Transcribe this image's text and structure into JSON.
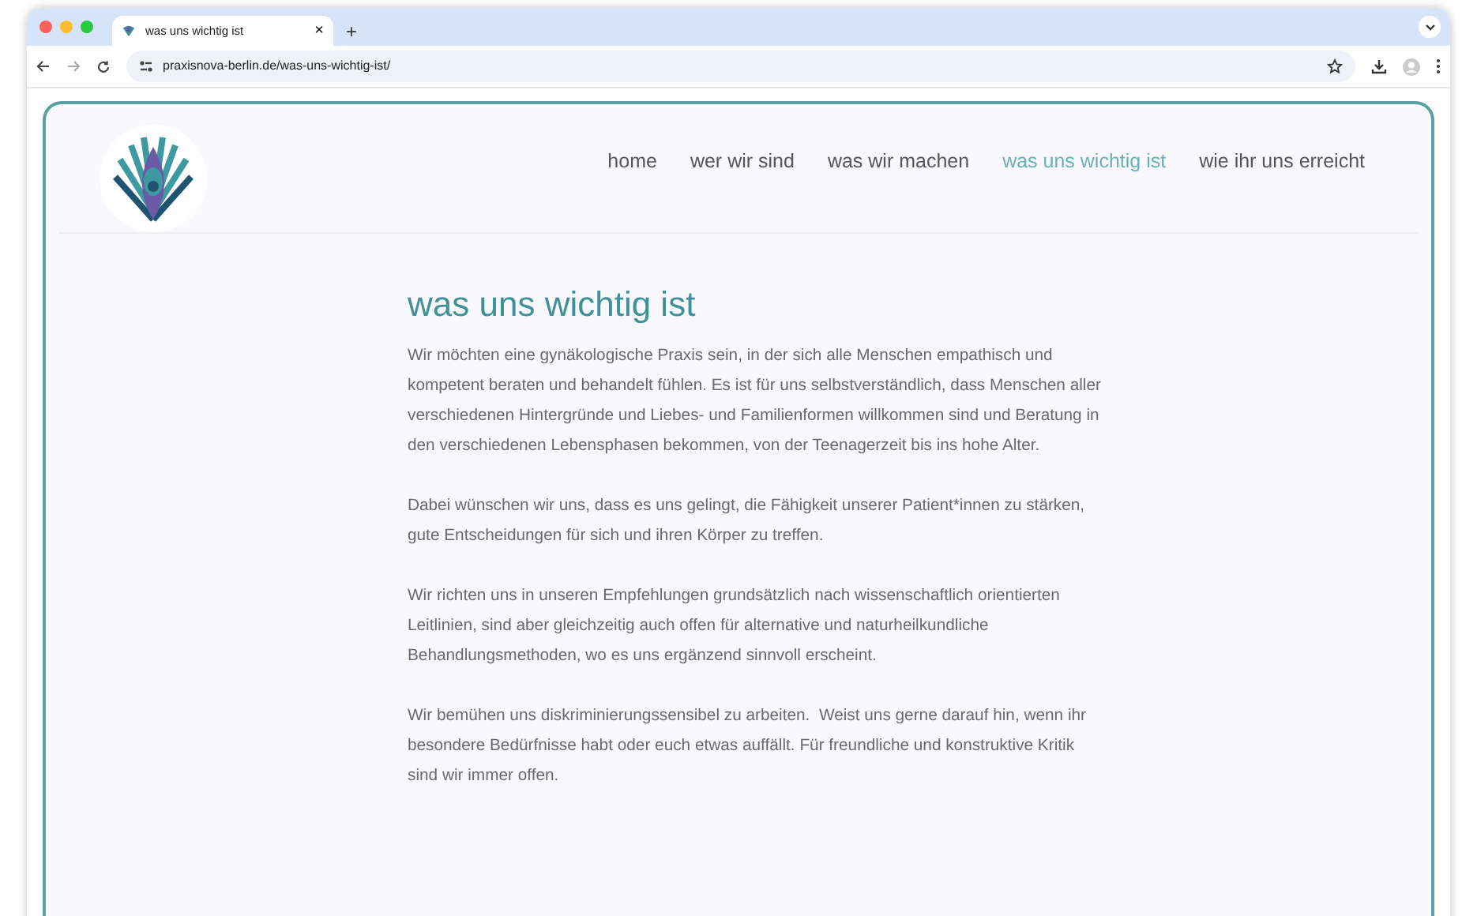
{
  "browser": {
    "tab": {
      "title": "was uns wichtig ist",
      "close": "×"
    },
    "new_tab": "+",
    "url": "praxisnova-berlin.de/was-uns-wichtig-ist/"
  },
  "page": {
    "nav": [
      {
        "label": "home",
        "selected": false
      },
      {
        "label": "wer wir sind",
        "selected": false
      },
      {
        "label": "was wir machen",
        "selected": false
      },
      {
        "label": "was uns wichtig ist",
        "selected": true
      },
      {
        "label": "wie ihr uns erreicht",
        "selected": false
      }
    ],
    "heading": "was uns wichtig ist",
    "paragraphs": [
      "Wir möchten eine gynäkologische Praxis sein, in der sich alle Menschen empathisch und kompetent beraten und behandelt fühlen. Es ist für uns selbstverständlich, dass Menschen aller verschiedenen Hintergründe und Liebes- und Familienformen willkommen sind und Beratung in den verschiedenen Lebensphasen bekommen, von der Teenagerzeit bis ins hohe Alter.",
      "Dabei wünschen wir uns, dass es uns gelingt, die Fähigkeit unserer Patient*innen zu stärken, gute Entscheidungen für sich und ihren Körper zu treffen.",
      "Wir richten uns in unseren Empfehlungen grundsätzlich nach wissenschaftlich orientierten Leitlinien, sind aber gleichzeitig auch offen für alternative und naturheilkundliche Behandlungsmethoden, wo es uns ergänzend sinnvoll erscheint.",
      "Wir bemühen uns diskriminierungssensibel zu arbeiten.  Weist uns gerne darauf hin, wenn ihr besondere Bedürfnisse habt oder euch etwas auffällt. Für freundliche und konstruktive Kritik sind wir immer offen."
    ]
  }
}
